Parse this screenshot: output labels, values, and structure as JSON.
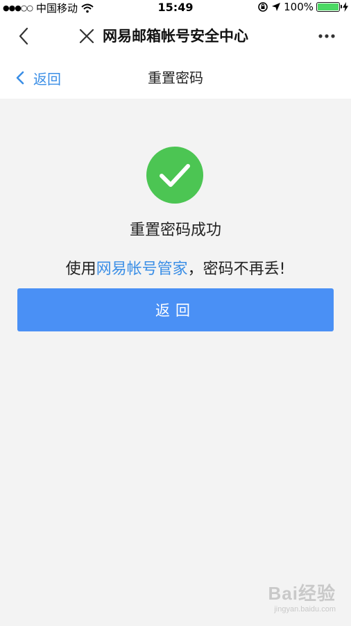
{
  "status_bar": {
    "signal": "●●●○○",
    "carrier": "中国移动",
    "time": "15:49",
    "battery_percent": "100%",
    "battery_level": 1.0
  },
  "nav": {
    "title": "网易邮箱帐号安全中心"
  },
  "sub_header": {
    "back_label": "返回",
    "title": "重置密码"
  },
  "main": {
    "success_title": "重置密码成功",
    "promo_prefix": "使用",
    "promo_link": "网易帐号管家",
    "promo_suffix": "，密码不再丢!",
    "return_button": "返回"
  },
  "colors": {
    "success": "#4cc553",
    "link": "#3a8ee6",
    "button": "#4a90f5"
  },
  "watermark": {
    "brand": "Bai经验",
    "sub": "jingyan.baidu.com"
  }
}
